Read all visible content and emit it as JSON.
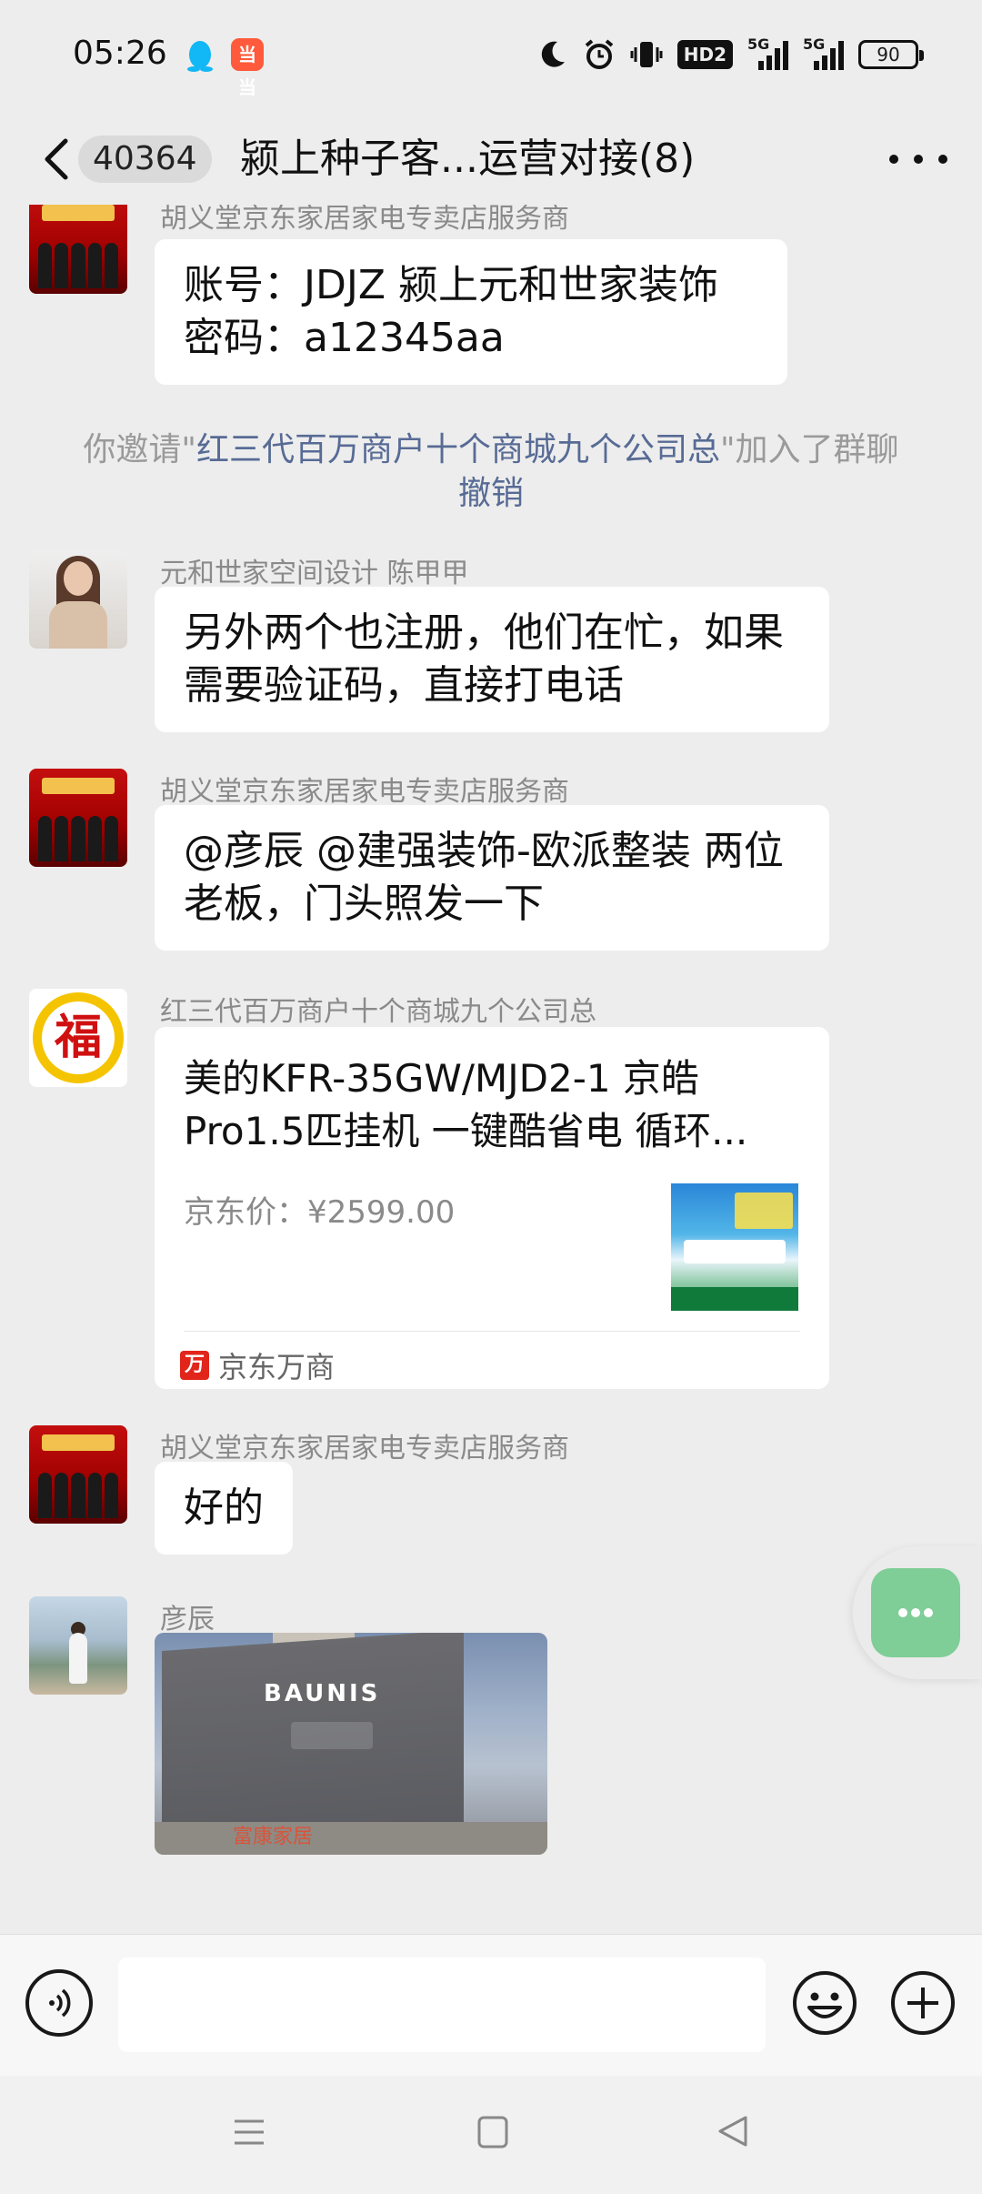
{
  "status_bar": {
    "time": "05:26",
    "app_icon_2": "当当",
    "hd_label": "HD2",
    "signal1_label": "5G",
    "signal2_label": "5G",
    "battery": "90"
  },
  "header": {
    "unread_count": "40364",
    "title": "颍上种子客...运营对接(8)"
  },
  "messages": [
    {
      "sender": "胡义堂京东家居家电专卖店服务商",
      "line1": "账号：JDJZ 颍上元和世家装饰",
      "line2": "密码：a12345aa"
    },
    {
      "system_prefix": "你邀请\"",
      "system_name": "红三代百万商户十个商城九个公司总",
      "system_suffix": "\"加入了群聊",
      "system_action": "撤销"
    },
    {
      "sender": "元和世家空间设计 陈甲甲",
      "line1": "另外两个也注册，他们在忙，如果",
      "line2": "需要验证码，直接打电话"
    },
    {
      "sender": "胡义堂京东家居家电专卖店服务商",
      "line1": "@彦辰 @建强装饰-欧派整装  两位",
      "line2": "老板，门头照发一下"
    },
    {
      "sender": "红三代百万商户十个商城九个公司总",
      "card_title_1": "美的KFR-35GW/MJD2-1  京皓",
      "card_title_2": "Pro1.5匹挂机 一键酷省电 循环...",
      "card_price": "京东价：¥2599.00",
      "card_source": "京东万商",
      "card_source_logo": "万"
    },
    {
      "sender": "胡义堂京东家居家电专卖店服务商",
      "text": "好的"
    },
    {
      "sender": "彦辰",
      "photo_brand": "BAUNIS",
      "photo_sign": "富康家居"
    }
  ],
  "input": {
    "placeholder": ""
  },
  "icons": {
    "back": "chevron-left-icon",
    "more": "more-dots-icon",
    "voice": "voice-icon",
    "emoji": "emoji-icon",
    "plus": "plus-icon",
    "float": "chat-dots-icon"
  },
  "colors": {
    "background": "#ededed",
    "bubble": "#ffffff",
    "link": "#576b95",
    "float_button": "#7fcd97"
  }
}
